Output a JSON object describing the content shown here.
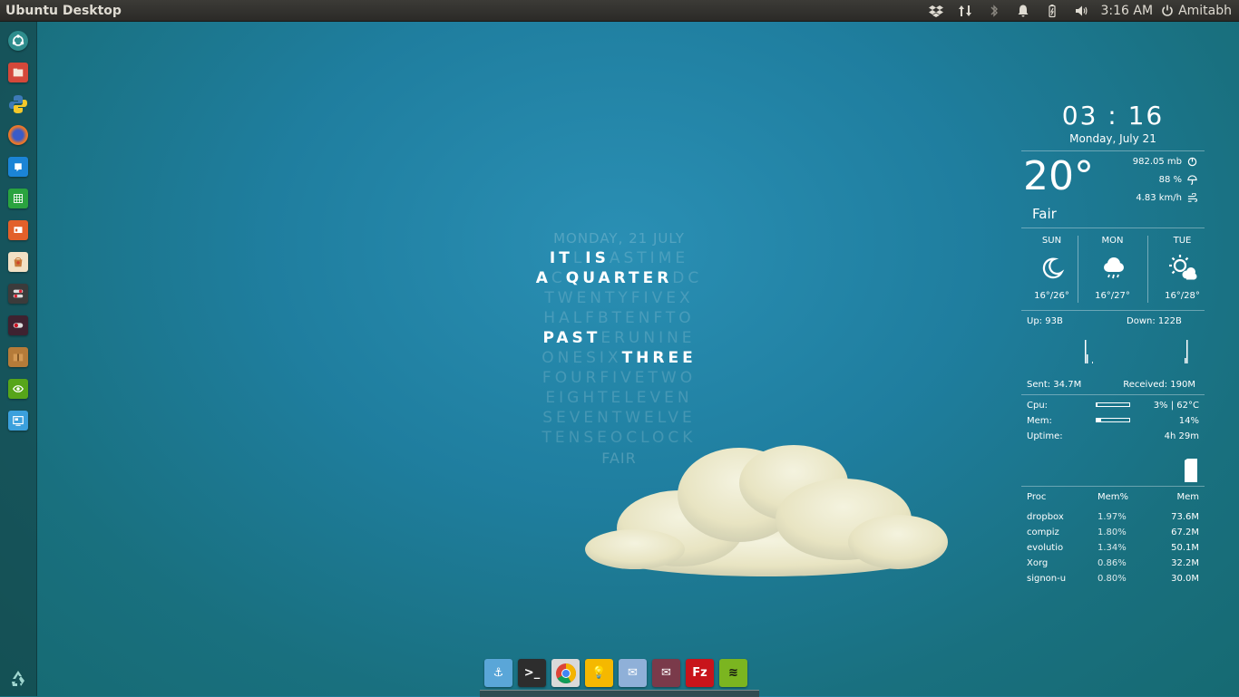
{
  "panel": {
    "title": "Ubuntu Desktop",
    "clock": "3:16 AM",
    "user": "Amitabh",
    "indicators": [
      "dropbox-icon",
      "network-arrows-icon",
      "bluetooth-icon",
      "bell-icon",
      "battery-icon",
      "volume-icon"
    ]
  },
  "launcher": {
    "items": [
      "ubuntu-dash-icon",
      "files-icon",
      "python-icon",
      "firefox-icon",
      "writer-icon",
      "calc-icon",
      "impress-icon",
      "software-center-icon",
      "settings-toggle-icon",
      "toggle-icon",
      "archive-icon",
      "nvidia-icon",
      "remote-desktop-icon",
      "recycle-icon"
    ]
  },
  "wordclock": {
    "date": "MONDAY, 21 JULY",
    "weather": "FAIR",
    "lines": [
      [
        {
          "t": "IT",
          "on": true
        },
        {
          "t": "L",
          "on": false
        },
        {
          "t": "IS",
          "on": true
        },
        {
          "t": "ASTIME",
          "on": false
        }
      ],
      [
        {
          "t": "A",
          "on": true
        },
        {
          "t": "C",
          "on": false
        },
        {
          "t": "QUARTER",
          "on": true
        },
        {
          "t": "DC",
          "on": false
        }
      ],
      [
        {
          "t": "TWENTYFIVEX",
          "on": false
        }
      ],
      [
        {
          "t": "HALFBTENFTO",
          "on": false
        }
      ],
      [
        {
          "t": "PAST",
          "on": true
        },
        {
          "t": "ERUNINE",
          "on": false
        }
      ],
      [
        {
          "t": "ONESIX",
          "on": false
        },
        {
          "t": "THREE",
          "on": true
        }
      ],
      [
        {
          "t": "FOURFIVETWO",
          "on": false
        }
      ],
      [
        {
          "t": "EIGHTELEVEN",
          "on": false
        }
      ],
      [
        {
          "t": "SEVENTWELVE",
          "on": false
        }
      ],
      [
        {
          "t": "TENSEOCLOCK",
          "on": false
        }
      ]
    ]
  },
  "conky": {
    "time": "03 : 16",
    "date": "Monday, July 21",
    "temp": "20°",
    "condition": "Fair",
    "pressure": "982.05 mb",
    "humidity": "88 %",
    "wind": "4.83 km/h",
    "forecast": [
      {
        "day": "SUN",
        "range": "16°/26°",
        "icon": "moon-icon"
      },
      {
        "day": "MON",
        "range": "16°/27°",
        "icon": "rain-cloud-icon"
      },
      {
        "day": "TUE",
        "range": "16°/28°",
        "icon": "sun-cloud-icon"
      }
    ],
    "net": {
      "up": "Up: 93B",
      "down": "Down: 122B",
      "sent": "Sent: 34.7M",
      "received": "Received: 190M"
    },
    "sys": {
      "cpu_label": "Cpu:",
      "cpu_value": "3% | 62°C",
      "cpu_fraction": 0.03,
      "mem_label": "Mem:",
      "mem_value": "14%",
      "mem_fraction": 0.14,
      "uptime_label": "Uptime:",
      "uptime_value": "4h 29m"
    },
    "proc": {
      "headers": [
        "Proc",
        "Mem%",
        "Mem"
      ],
      "rows": [
        [
          "dropbox",
          "1.97%",
          "73.6M"
        ],
        [
          "compiz",
          "1.80%",
          "67.2M"
        ],
        [
          "evolutio",
          "1.34%",
          "50.1M"
        ],
        [
          "Xorg",
          "0.86%",
          "32.2M"
        ],
        [
          "signon-u",
          "0.80%",
          "30.0M"
        ]
      ]
    }
  },
  "dock": {
    "items": [
      {
        "name": "anchor-icon",
        "bg": "#5aa6d8",
        "glyph": "⚓"
      },
      {
        "name": "terminal-icon",
        "bg": "#2d2d2d",
        "glyph": ">_"
      },
      {
        "name": "chrome-icon",
        "bg": "#d9d9d9",
        "glyph": "●"
      },
      {
        "name": "lightbulb-icon",
        "bg": "#f5b800",
        "glyph": "💡"
      },
      {
        "name": "maps-icon",
        "bg": "#8fb0d8",
        "glyph": "✉"
      },
      {
        "name": "mail-icon",
        "bg": "#7a3a4a",
        "glyph": "✉"
      },
      {
        "name": "filezilla-icon",
        "bg": "#c8141b",
        "glyph": "Fz"
      },
      {
        "name": "spotify-icon",
        "bg": "#7bb520",
        "glyph": "≋"
      }
    ]
  }
}
